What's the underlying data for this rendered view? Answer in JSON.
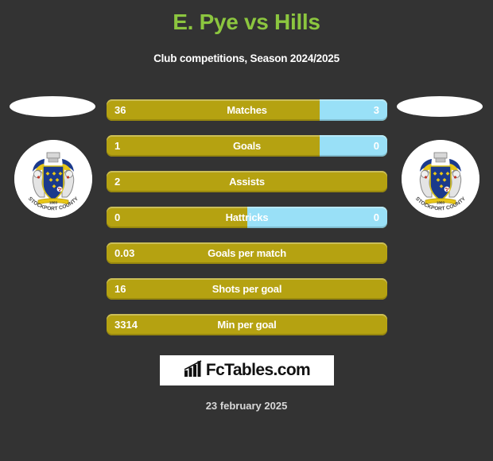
{
  "header": {
    "title": "E. Pye vs Hills",
    "subtitle": "Club competitions, Season 2024/2025"
  },
  "colors": {
    "background": "#333333",
    "title_green": "#8cc63f",
    "home_bar_gold": "#b5a211",
    "away_bar_blue": "#99e0f7",
    "text_white": "#ffffff"
  },
  "badges": {
    "home": {
      "name": "club-crest-stockport-county",
      "ribbon_text": "STOCKPORT COUNTY"
    },
    "away": {
      "name": "club-crest-stockport-county",
      "ribbon_text": "STOCKPORT COUNTY"
    }
  },
  "chart_data": {
    "type": "bar",
    "title": "E. Pye vs Hills",
    "subtitle": "Club competitions, Season 2024/2025",
    "orientation": "horizontal-paired",
    "players": [
      "E. Pye",
      "Hills"
    ],
    "categories": [
      "Matches",
      "Goals",
      "Assists",
      "Hattricks",
      "Goals per match",
      "Shots per goal",
      "Min per goal"
    ],
    "series": [
      {
        "name": "E. Pye",
        "values": [
          "36",
          "1",
          "2",
          "0",
          "0.03",
          "16",
          "3314"
        ]
      },
      {
        "name": "Hills",
        "values": [
          "3",
          "0",
          "",
          "0",
          "",
          "",
          ""
        ]
      }
    ],
    "rows": [
      {
        "label": "Matches",
        "left": "36",
        "right": "3",
        "left_pct": 76,
        "right_pct": 24,
        "has_right": true
      },
      {
        "label": "Goals",
        "left": "1",
        "right": "0",
        "left_pct": 76,
        "right_pct": 24,
        "has_right": true
      },
      {
        "label": "Assists",
        "left": "2",
        "right": "",
        "left_pct": 100,
        "right_pct": 0,
        "has_right": false
      },
      {
        "label": "Hattricks",
        "left": "0",
        "right": "0",
        "left_pct": 50,
        "right_pct": 50,
        "has_right": true
      },
      {
        "label": "Goals per match",
        "left": "0.03",
        "right": "",
        "left_pct": 100,
        "right_pct": 0,
        "has_right": false
      },
      {
        "label": "Shots per goal",
        "left": "16",
        "right": "",
        "left_pct": 100,
        "right_pct": 0,
        "has_right": false
      },
      {
        "label": "Min per goal",
        "left": "3314",
        "right": "",
        "left_pct": 100,
        "right_pct": 0,
        "has_right": false
      }
    ]
  },
  "footer": {
    "brand": "FcTables.com",
    "brand_icon": "bar-chart-icon",
    "date": "23 february 2025"
  }
}
